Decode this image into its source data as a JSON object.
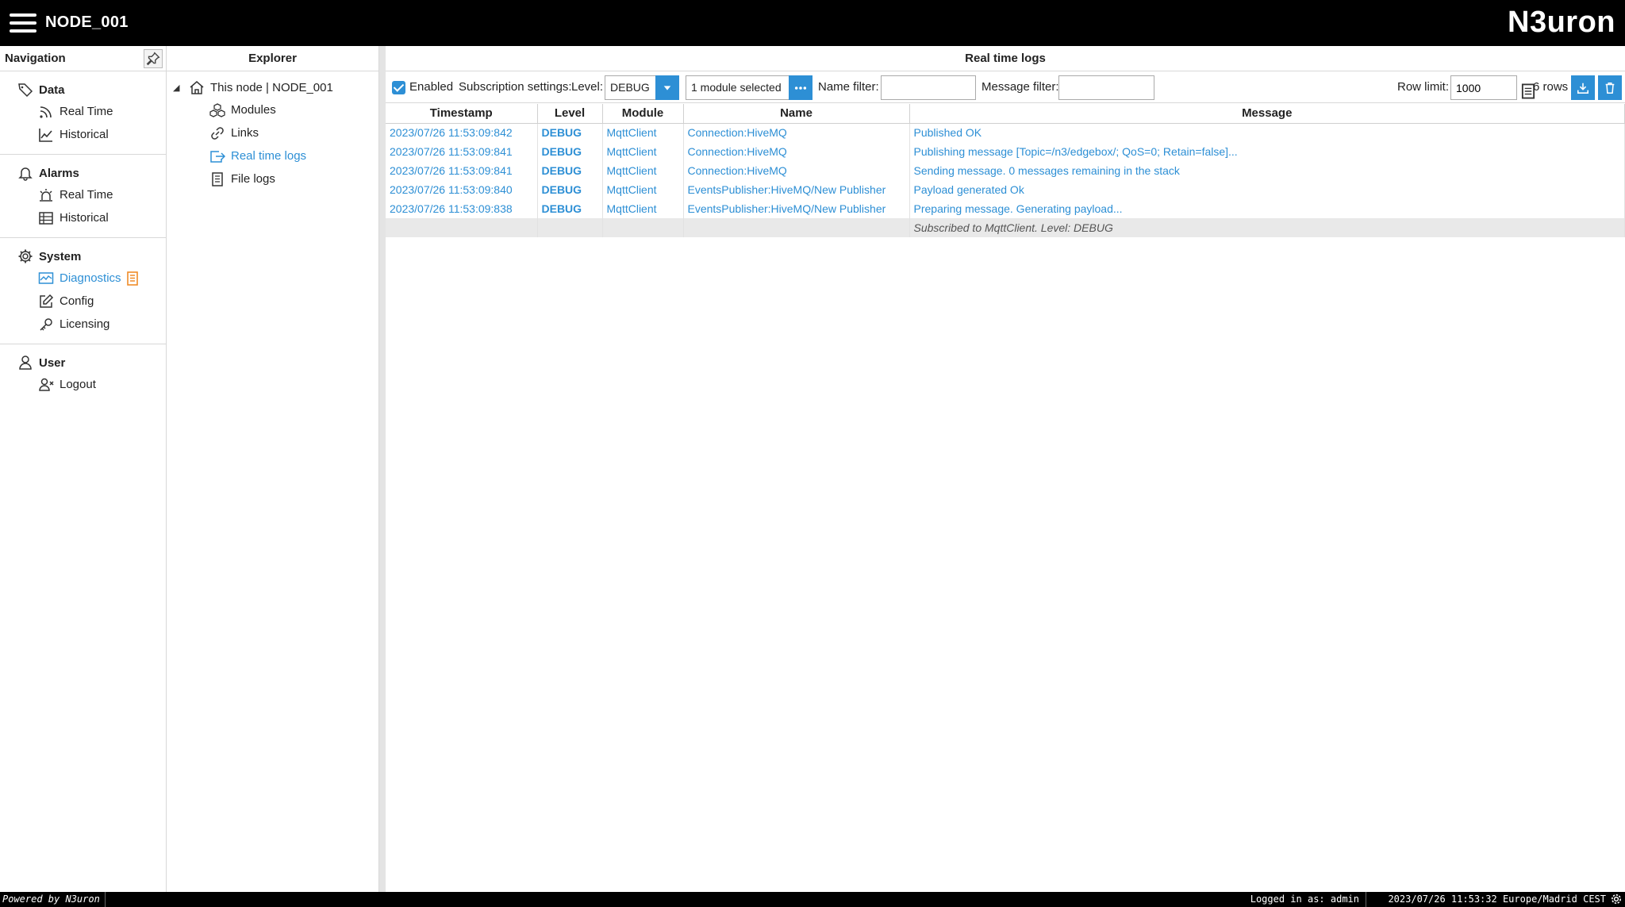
{
  "header": {
    "node_title": "NODE_001",
    "brand": "N3uron"
  },
  "navigation": {
    "title": "Navigation",
    "sections": [
      {
        "label": "Data",
        "icon": "tag-icon",
        "items": [
          {
            "label": "Real Time",
            "icon": "realtime-signal-icon"
          },
          {
            "label": "Historical",
            "icon": "line-chart-icon"
          }
        ]
      },
      {
        "label": "Alarms",
        "icon": "bell-icon",
        "items": [
          {
            "label": "Real Time",
            "icon": "alarm-realtime-icon"
          },
          {
            "label": "Historical",
            "icon": "table-icon"
          }
        ]
      },
      {
        "label": "System",
        "icon": "gear-icon",
        "items": [
          {
            "label": "Diagnostics",
            "icon": "diagnostics-icon",
            "active": true
          },
          {
            "label": "Config",
            "icon": "edit-icon"
          },
          {
            "label": "Licensing",
            "icon": "key-icon"
          }
        ]
      },
      {
        "label": "User",
        "icon": "user-icon",
        "items": [
          {
            "label": "Logout",
            "icon": "logout-icon"
          }
        ]
      }
    ]
  },
  "explorer": {
    "title": "Explorer",
    "root": "This node | NODE_001",
    "items": [
      {
        "label": "Modules",
        "icon": "modules-icon"
      },
      {
        "label": "Links",
        "icon": "link-icon"
      },
      {
        "label": "Real time logs",
        "icon": "realtime-logs-icon",
        "active": true
      },
      {
        "label": "File logs",
        "icon": "file-logs-icon"
      }
    ]
  },
  "main": {
    "title": "Real time logs",
    "toolbar": {
      "enabled_label": "Enabled",
      "subscription_label": "Subscription settings:",
      "level_label": "Level:",
      "level_value": "DEBUG",
      "modules_value": "1 module selected",
      "name_filter_label": "Name filter:",
      "name_filter_value": "",
      "message_filter_label": "Message filter:",
      "message_filter_value": "",
      "row_limit_label": "Row limit:",
      "row_limit_value": "1000",
      "rows_count": "6 rows"
    },
    "columns": [
      "Timestamp",
      "Level",
      "Module",
      "Name",
      "Message"
    ],
    "rows": [
      {
        "timestamp": "2023/07/26 11:53:09:842",
        "level": "DEBUG",
        "module": "MqttClient",
        "name": "Connection:HiveMQ",
        "message": "Published OK"
      },
      {
        "timestamp": "2023/07/26 11:53:09:841",
        "level": "DEBUG",
        "module": "MqttClient",
        "name": "Connection:HiveMQ",
        "message": "Publishing message [Topic=/n3/edgebox/; QoS=0; Retain=false]..."
      },
      {
        "timestamp": "2023/07/26 11:53:09:841",
        "level": "DEBUG",
        "module": "MqttClient",
        "name": "Connection:HiveMQ",
        "message": "Sending message. 0 messages remaining in the stack"
      },
      {
        "timestamp": "2023/07/26 11:53:09:840",
        "level": "DEBUG",
        "module": "MqttClient",
        "name": "EventsPublisher:HiveMQ/New Publisher",
        "message": "Payload generated Ok"
      },
      {
        "timestamp": "2023/07/26 11:53:09:838",
        "level": "DEBUG",
        "module": "MqttClient",
        "name": "EventsPublisher:HiveMQ/New Publisher",
        "message": "Preparing message. Generating payload..."
      }
    ],
    "subscription_note": "Subscribed to MqttClient. Level: DEBUG"
  },
  "footer": {
    "powered": "Powered by N3uron",
    "login": "Logged in as: admin",
    "clock": "2023/07/26 11:53:32 Europe/Madrid CEST"
  },
  "colors": {
    "accent": "#2d8fd5",
    "header_bg": "#000000",
    "badge": "#f08c28"
  }
}
